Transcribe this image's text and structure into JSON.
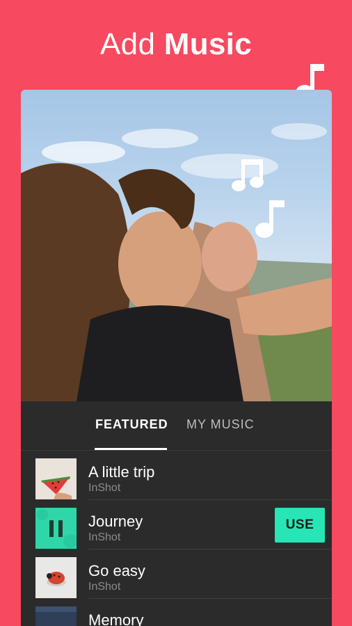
{
  "header": {
    "title_light": "Add",
    "title_bold": "Music"
  },
  "tabs": [
    {
      "label": "FEATURED",
      "active": true
    },
    {
      "label": "MY MUSIC",
      "active": false
    }
  ],
  "tracks": [
    {
      "title": "A little trip",
      "artist": "InShot",
      "thumb": "watermelon-thumbnail"
    },
    {
      "title": "Journey",
      "artist": "InShot",
      "thumb": "pause-icon",
      "playing": true,
      "action_label": "USE"
    },
    {
      "title": "Go easy",
      "artist": "InShot",
      "thumb": "ladybug-thumbnail"
    },
    {
      "title": "Memory",
      "artist": "",
      "thumb": "memory-thumbnail"
    }
  ],
  "colors": {
    "background": "#F7495F",
    "panel": "#2B2B2B",
    "accent": "#27E5B4",
    "text_primary": "#FFFFFF",
    "text_secondary": "#8C8C8C"
  }
}
